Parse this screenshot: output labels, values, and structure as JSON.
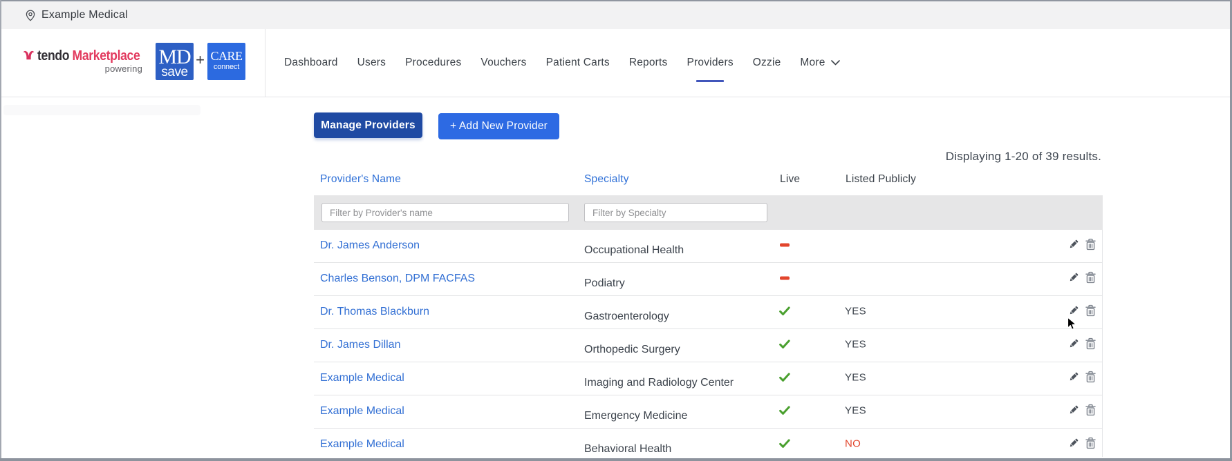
{
  "topbar": {
    "location_label": "Example Medical"
  },
  "header": {
    "brand": {
      "name_primary": "tendo",
      "name_secondary": "Marketplace",
      "powering_label": "powering",
      "mdsave_line1": "MD",
      "mdsave_line2": "save",
      "plus": "+",
      "careconnect_line1": "CARE",
      "careconnect_line2": "connect"
    },
    "nav": {
      "items": [
        {
          "label": "Dashboard",
          "active": false
        },
        {
          "label": "Users",
          "active": false
        },
        {
          "label": "Procedures",
          "active": false
        },
        {
          "label": "Vouchers",
          "active": false
        },
        {
          "label": "Patient Carts",
          "active": false
        },
        {
          "label": "Reports",
          "active": false
        },
        {
          "label": "Providers",
          "active": true
        },
        {
          "label": "Ozzie",
          "active": false
        },
        {
          "label": "More",
          "active": false
        }
      ]
    }
  },
  "toolbar": {
    "manage_label": "Manage Providers",
    "add_label": "+ Add New Provider"
  },
  "results_summary": "Displaying 1-20 of 39 results.",
  "table": {
    "columns": {
      "name": "Provider's Name",
      "specialty": "Specialty",
      "live": "Live",
      "listed": "Listed Publicly"
    },
    "filters": {
      "name_placeholder": "Filter by Provider's name",
      "specialty_placeholder": "Filter by Specialty"
    },
    "rows": [
      {
        "name": "Dr. James Anderson",
        "specialty": "Occupational Health",
        "live": "no",
        "listed": ""
      },
      {
        "name": "Charles Benson, DPM FACFAS",
        "specialty": "Podiatry",
        "live": "no",
        "listed": ""
      },
      {
        "name": "Dr. Thomas Blackburn",
        "specialty": "Gastroenterology",
        "live": "yes",
        "listed": "YES"
      },
      {
        "name": "Dr. James Dillan",
        "specialty": "Orthopedic Surgery",
        "live": "yes",
        "listed": "YES"
      },
      {
        "name": "Example Medical",
        "specialty": "Imaging and Radiology Center",
        "live": "yes",
        "listed": "YES"
      },
      {
        "name": "Example Medical",
        "specialty": "Emergency Medicine",
        "live": "yes",
        "listed": "YES"
      },
      {
        "name": "Example Medical",
        "specialty": "Behavioral Health",
        "live": "yes",
        "listed": "NO"
      }
    ]
  },
  "colors": {
    "accent_dark_blue": "#1f4aa3",
    "accent_blue": "#2d6ae3",
    "link_blue": "#3370d4",
    "brand_pink": "#e23b5f",
    "live_green": "#4aa02f",
    "alert_red": "#e2452c",
    "active_tab_underline": "#4156bb"
  }
}
